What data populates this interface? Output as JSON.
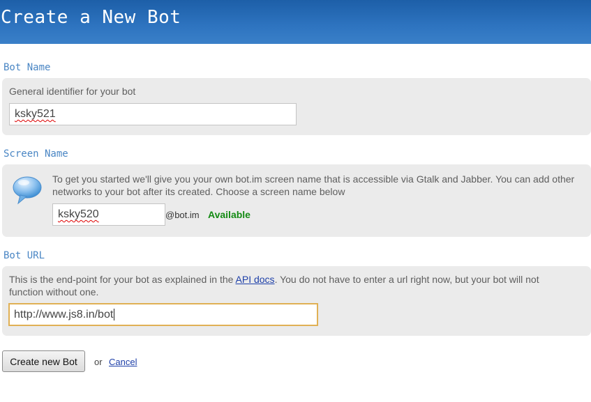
{
  "page": {
    "title": "Create a New Bot"
  },
  "bot_name": {
    "heading": "Bot Name",
    "help": "General identifier for your bot",
    "value": "ksky521"
  },
  "screen_name": {
    "heading": "Screen Name",
    "help": "To get you started we'll give you your own bot.im screen name that is accessible via Gtalk and Jabber. You can add other networks to your bot after its created. Choose a screen name below",
    "value": "ksky520",
    "suffix": "@bot.im",
    "status": "Available",
    "status_color": "#138a13",
    "icon": "speech-bubble-icon"
  },
  "bot_url": {
    "heading": "Bot URL",
    "help_before": "This is the end-point for your bot as explained in the ",
    "help_link": "API docs",
    "help_after": ". You do not have to enter a url right now, but your bot will not function without one.",
    "value": "http://www.js8.in/bot"
  },
  "actions": {
    "submit_label": "Create new Bot",
    "or_text": "or",
    "cancel_label": "Cancel"
  },
  "colors": {
    "header_blue": "#2e74c0",
    "heading_blue": "#4a86c4",
    "panel_gray": "#ebebeb",
    "focus_orange": "#e0b054"
  }
}
